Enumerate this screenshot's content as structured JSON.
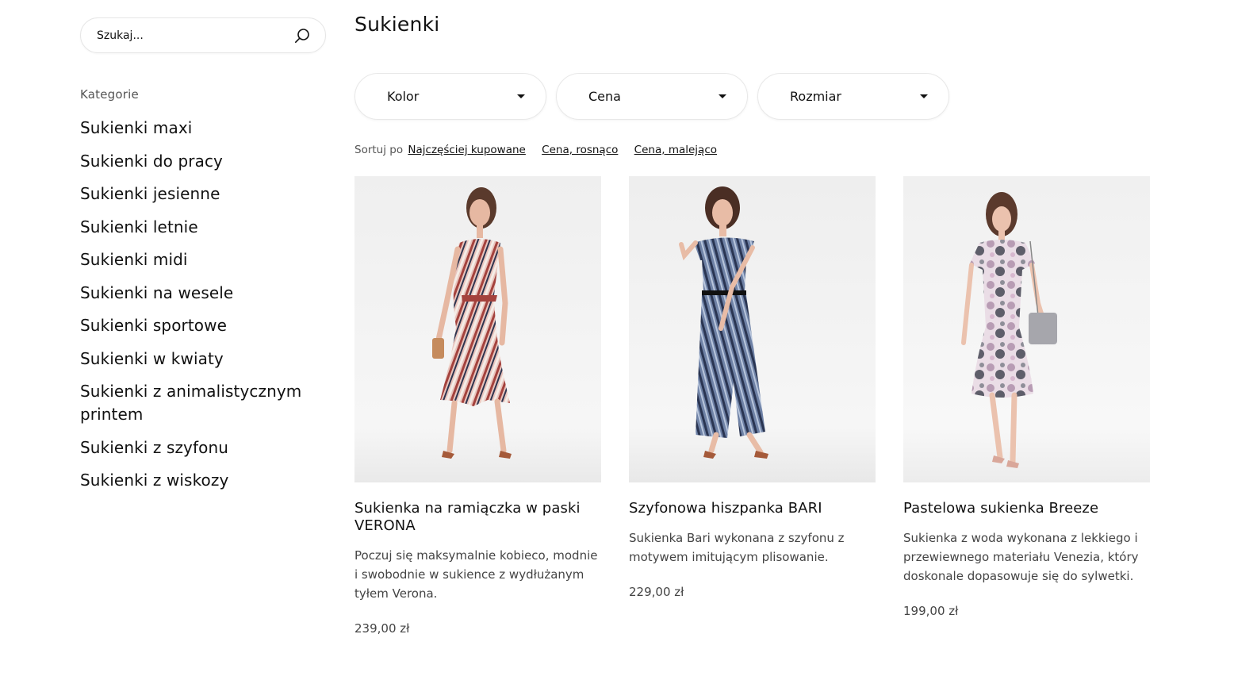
{
  "search": {
    "placeholder": "Szukaj..."
  },
  "sidebar": {
    "heading": "Kategorie",
    "categories": [
      "Sukienki maxi",
      "Sukienki do pracy",
      "Sukienki jesienne",
      "Sukienki letnie",
      "Sukienki midi",
      "Sukienki na wesele",
      "Sukienki sportowe",
      "Sukienki w kwiaty",
      "Sukienki z animalistycznym printem",
      "Sukienki z szyfonu",
      "Sukienki z wiskozy"
    ]
  },
  "main": {
    "title": "Sukienki",
    "filters": [
      "Kolor",
      "Cena",
      "Rozmiar"
    ],
    "sort": {
      "label": "Sortuj po",
      "options": [
        "Najczęściej kupowane",
        "Cena, rosnąco",
        "Cena, malejąco"
      ]
    },
    "products": [
      {
        "title": "Sukienka na ramiączka w paski VERONA",
        "description": "Poczuj się maksymalnie kobieco, modnie i swobodnie w sukience z wydłużanym tyłem Verona.",
        "price": "239,00 zł"
      },
      {
        "title": "Szyfonowa hiszpanka BARI",
        "description": "Sukienka Bari wykonana z szyfonu z motywem imitującym plisowanie.",
        "price": "229,00 zł"
      },
      {
        "title": "Pastelowa sukienka Breeze",
        "description": "Sukienka z woda wykonana z lekkiego i przewiewnego materiału Venezia, który doskonale dopasowuje się do sylwetki.",
        "price": "199,00 zł"
      }
    ]
  }
}
